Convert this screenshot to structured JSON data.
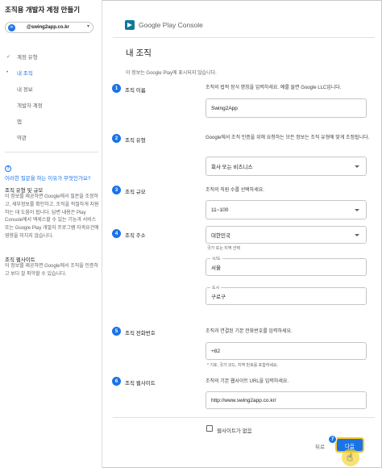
{
  "sidebar": {
    "title": "조직용 개발자 계정 만들기",
    "account": {
      "avatar_letter": "in",
      "email": "@swing2app.co.kr"
    },
    "nav": [
      {
        "label": "계정 유형",
        "state": "done",
        "mark": "✓"
      },
      {
        "label": "내 조직",
        "state": "active",
        "mark": "•"
      },
      {
        "label": "내 정보",
        "state": "",
        "mark": ""
      },
      {
        "label": "개발자 계정",
        "state": "",
        "mark": ""
      },
      {
        "label": "앱",
        "state": "",
        "mark": ""
      },
      {
        "label": "약관",
        "state": "",
        "mark": ""
      }
    ],
    "help": {
      "link": "이러한 질문을 하는 이유가 무엇인가요?",
      "h1": "조직 유형 및 규모",
      "p1": "이 정보를 제공하면 Google에서 질문을 조정하고, 세부정보를 확인하고, 조직을 적절하게 지원하는 데 도움이 됩니다. 답변 내용은 Play Console에서 액세스할 수 있는 기능과 서비스 또는 Google Play 개발자 프로그램 자격요건에 영향을 미치지 않습니다.",
      "h2": "조직 웹사이트",
      "p2": "이 정보를 제공하면 Google에서 조직을 인증하고 보다 잘 파악할 수 있습니다."
    }
  },
  "main": {
    "logo_text": "Google Play Console",
    "title": "내 조직",
    "subtitle": "이 정보는 Google Play에 표시되지 않습니다.",
    "sections": {
      "name": {
        "num": "1",
        "label": "조직 이름",
        "desc": "조직의 법적 정식 명칭을 입력하세요. 예를 들면 Google LLC입니다.",
        "value": "Swing2App"
      },
      "type": {
        "num": "2",
        "label": "조직 유형",
        "desc": "Google에서 조직 인증을 위해 요청하는 모든 정보는 조직 유형에 맞게 조정됩니다.",
        "value": "회사 또는 비즈니스"
      },
      "size": {
        "num": "3",
        "label": "조직 규모",
        "desc": "조직의 직원 수를 선택하세요.",
        "value": "11~100"
      },
      "address": {
        "num": "4",
        "label": "조직 주소",
        "country": "대한민국",
        "country_hint": "국가 또는 지역 선택",
        "city_label": "시/도",
        "city": "서울",
        "district_label": "도시",
        "district": "구로구"
      },
      "phone": {
        "num": "5",
        "label": "조직 전화번호",
        "desc": "조직과 연결된 기본 전화번호를 입력하세요.",
        "value": "+82",
        "hint": "* 기호, 국가 코드, 지역 번호를 포함하세요."
      },
      "website": {
        "num": "6",
        "label": "조직 웹사이트",
        "desc": "조직의 기본 웹사이트 URL을 입력하세요.",
        "value": "http://www.swing2app.co.kr/",
        "no_site": "웹사이트가 없음"
      }
    },
    "footer": {
      "back": "뒤로",
      "next": "다음",
      "next_step": "7"
    }
  }
}
